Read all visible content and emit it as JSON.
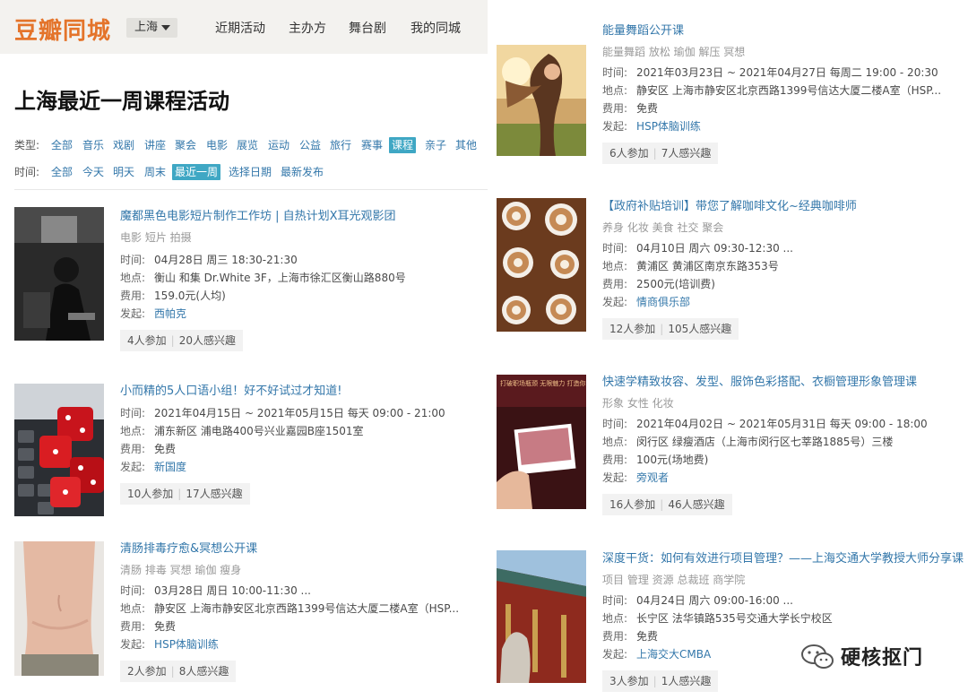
{
  "header": {
    "logo": "豆瓣同城",
    "city": "上海",
    "nav": [
      "近期活动",
      "主办方",
      "舞台剧",
      "我的同城"
    ]
  },
  "page_title": "上海最近一周课程活动",
  "filters": {
    "type_label": "类型:",
    "types": [
      "全部",
      "音乐",
      "戏剧",
      "讲座",
      "聚会",
      "电影",
      "展览",
      "运动",
      "公益",
      "旅行",
      "赛事",
      "课程",
      "亲子",
      "其他"
    ],
    "type_selected": "课程",
    "time_label": "时间:",
    "times": [
      "全部",
      "今天",
      "明天",
      "周末",
      "最近一周",
      "选择日期",
      "最新发布"
    ],
    "time_selected": "最近一周"
  },
  "labels": {
    "time": "时间:",
    "place": "地点:",
    "fee": "费用:",
    "host": "发起:"
  },
  "events_left": [
    {
      "title": "魔都黑色电影短片制作工作坊 | 自热计划X耳光观影团",
      "tags": "电影  短片  拍摄",
      "time": "04月28日 周三 18:30-21:30",
      "place": "衡山 和集 Dr.White 3F，上海市徐汇区衡山路880号",
      "fee": "159.0元(人均)",
      "host": "西帕克",
      "joined": "4人参加",
      "interested": "20人感兴趣"
    },
    {
      "title": "小而精的5人口语小组！好不好试过才知道!",
      "tags": "",
      "time": "2021年04月15日 ~ 2021年05月15日 每天 09:00 - 21:00",
      "place": "浦东新区 浦电路400号兴业嘉园B座1501室",
      "fee": "免费",
      "host": "新国度",
      "joined": "10人参加",
      "interested": "17人感兴趣"
    },
    {
      "title": "清肠排毒疗愈&冥想公开课",
      "tags": "清肠  排毒  冥想  瑜伽  瘦身",
      "time": "03月28日 周日 10:00-11:30 ...",
      "place": "静安区 上海市静安区北京西路1399号信达大厦二楼A室（HSP...",
      "fee": "免费",
      "host": "HSP体脑训练",
      "joined": "2人参加",
      "interested": "8人感兴趣"
    }
  ],
  "events_right": [
    {
      "title": "能量舞蹈公开课",
      "tags": "能量舞蹈  放松  瑜伽  解压  冥想",
      "time": "2021年03月23日 ~ 2021年04月27日 每周二 19:00 - 20:30",
      "place": "静安区 上海市静安区北京西路1399号信达大厦二楼A室（HSP...",
      "fee": "免费",
      "host": "HSP体脑训练",
      "joined": "6人参加",
      "interested": "7人感兴趣"
    },
    {
      "title": "【政府补贴培训】带您了解咖啡文化~经典咖啡师",
      "tags": "养身  化妆  美食  社交  聚会",
      "time": "04月10日 周六 09:30-12:30 ...",
      "place": "黄浦区 黄浦区南京东路353号",
      "fee": "2500元(培训费)",
      "host": "情商俱乐部",
      "joined": "12人参加",
      "interested": "105人感兴趣"
    },
    {
      "title": "快速学精致妆容、发型、服饰色彩搭配、衣橱管理形象管理课",
      "tags": "形象  女性  化妆",
      "time": "2021年04月02日 ~ 2021年05月31日 每天 09:00 - 18:00",
      "place": "闵行区 绿瘦酒店（上海市闵行区七莘路1885号）三楼",
      "fee": "100元(场地费)",
      "host": "旁观者",
      "joined": "16人参加",
      "interested": "46人感兴趣",
      "poster_text": "打破职场瓶颈 无限魅力 打造你的职场影响力"
    },
    {
      "title": "深度干货：如何有效进行项目管理？——上海交通大学教授大师分享课",
      "tags": "项目  管理  资源  总裁班  商学院",
      "time": "04月24日 周六 09:00-16:00 ...",
      "place": "长宁区 法华镇路535号交通大学长宁校区",
      "fee": "免费",
      "host": "上海交大CMBA",
      "joined": "3人参加",
      "interested": "1人感兴趣"
    }
  ],
  "watermark": "硬核抠门",
  "colors": {
    "brand": "#e4742b",
    "link": "#3377aa",
    "selected": "#3fa7c4"
  }
}
